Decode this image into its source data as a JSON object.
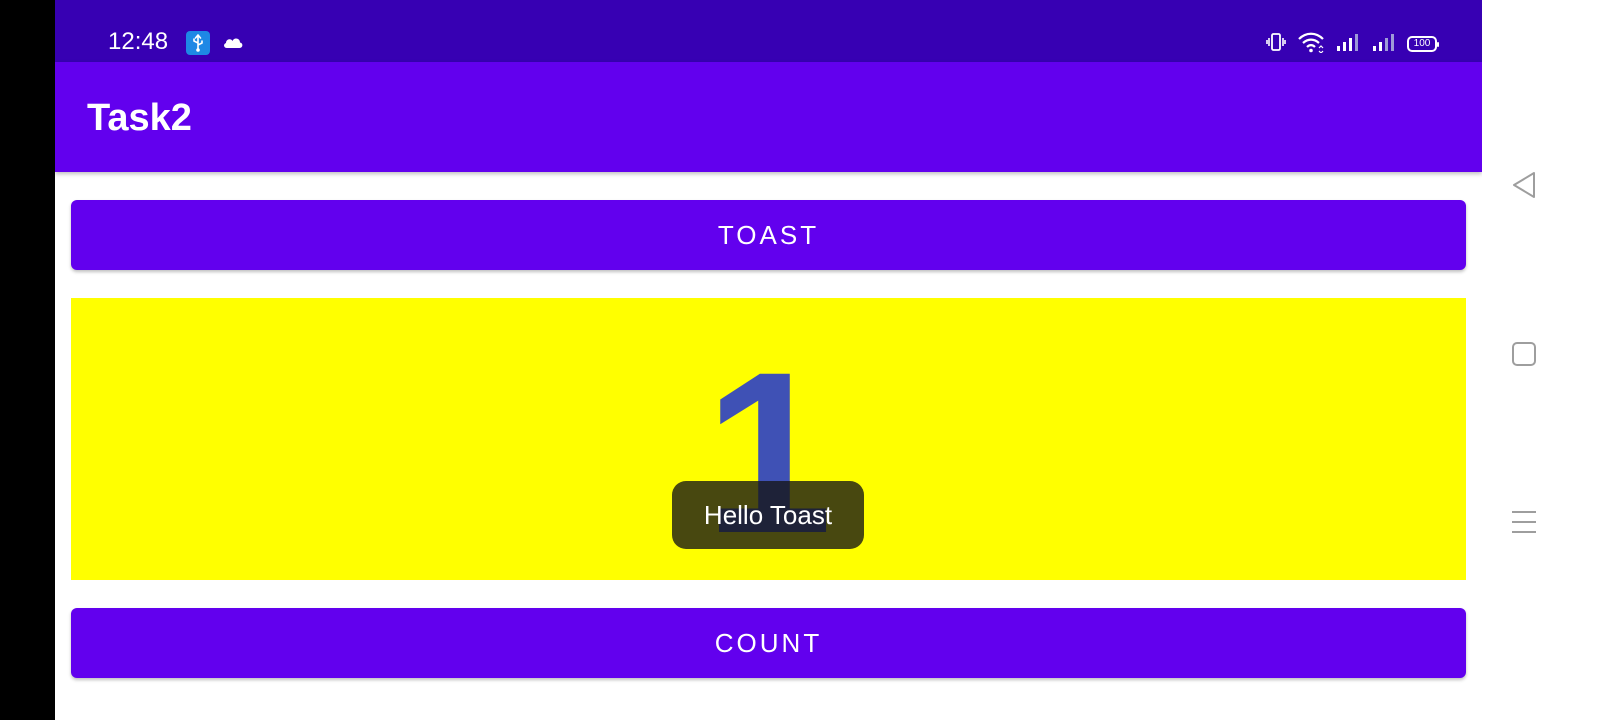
{
  "status_bar": {
    "time": "12:48",
    "battery_level": "100",
    "icons": [
      "usb-icon",
      "cloud-icon",
      "vibrate-icon",
      "wifi-icon",
      "signal-icon",
      "signal-icon-2",
      "battery-icon"
    ]
  },
  "app_bar": {
    "title": "Task2"
  },
  "main": {
    "toast_button_label": "TOAST",
    "count_value": "1",
    "count_button_label": "COUNT"
  },
  "toast_message": {
    "text": "Hello Toast"
  },
  "nav_bar": {
    "icons": [
      "back-icon",
      "recents-icon",
      "menu-icon"
    ]
  },
  "colors": {
    "status_bar": "#3700b3",
    "primary": "#6200ee",
    "count_background": "#ffff00",
    "count_text": "#3f51b5"
  }
}
